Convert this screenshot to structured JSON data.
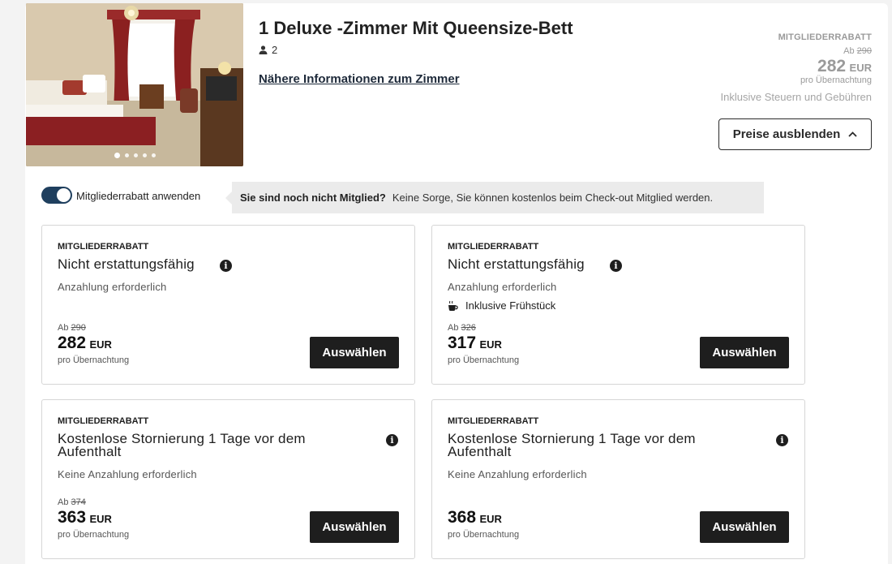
{
  "room": {
    "title": "1 Deluxe -Zimmer Mit Queensize-Bett",
    "guests": "2",
    "info_link": "Nähere Informationen zum Zimmer",
    "photo_dots": 5,
    "photo_active": 1
  },
  "summary": {
    "badge": "MITGLIEDERRABATT",
    "from_prefix": "Ab",
    "old_price": "290",
    "price": "282",
    "currency": "EUR",
    "per_night": "pro Übernachtung",
    "taxes": "Inklusive Steuern und Gebühren",
    "hide_button": "Preise ausblenden"
  },
  "member": {
    "toggle_label": "Mitgliederrabatt anwenden",
    "toggle_on": true,
    "notice_bold": "Sie sind noch nicht Mitglied?",
    "notice_text": "Keine Sorge, Sie können kostenlos beim Check-out Mitglied werden."
  },
  "rates": [
    {
      "badge": "MITGLIEDERRABATT",
      "title": "Nicht erstattungsfähig",
      "subtitle": "Anzahlung erforderlich",
      "extra": "",
      "from_prefix": "Ab",
      "old_price": "290",
      "price": "282",
      "currency": "EUR",
      "per_night": "pro Übernachtung",
      "button": "Auswählen"
    },
    {
      "badge": "MITGLIEDERRABATT",
      "title": "Nicht erstattungsfähig",
      "subtitle": "Anzahlung erforderlich",
      "extra": "Inklusive Frühstück",
      "from_prefix": "Ab",
      "old_price": "326",
      "price": "317",
      "currency": "EUR",
      "per_night": "pro Übernachtung",
      "button": "Auswählen"
    },
    {
      "badge": "MITGLIEDERRABATT",
      "title": "Kostenlose Stornierung 1 Tage vor dem Aufenthalt",
      "subtitle": "Keine Anzahlung erforderlich",
      "extra": "",
      "from_prefix": "Ab",
      "old_price": "374",
      "price": "363",
      "currency": "EUR",
      "per_night": "pro Übernachtung",
      "button": "Auswählen"
    },
    {
      "badge": "MITGLIEDERRABATT",
      "title": "Kostenlose Stornierung 1 Tage vor dem Aufenthalt",
      "subtitle": "Keine Anzahlung erforderlich",
      "extra": "",
      "from_prefix": "",
      "old_price": "",
      "price": "368",
      "currency": "EUR",
      "per_night": "pro Übernachtung",
      "button": "Auswählen"
    }
  ],
  "colors": {
    "toggle": "#1f3f5e",
    "button_dark": "#1e1e1e",
    "notice_bg": "#ebebeb",
    "muted_price": "#9a9a9a"
  },
  "icons": {
    "guests": "person-icon",
    "info": "info-icon",
    "breakfast": "coffee-cup-icon",
    "collapse": "chevron-up-icon"
  }
}
